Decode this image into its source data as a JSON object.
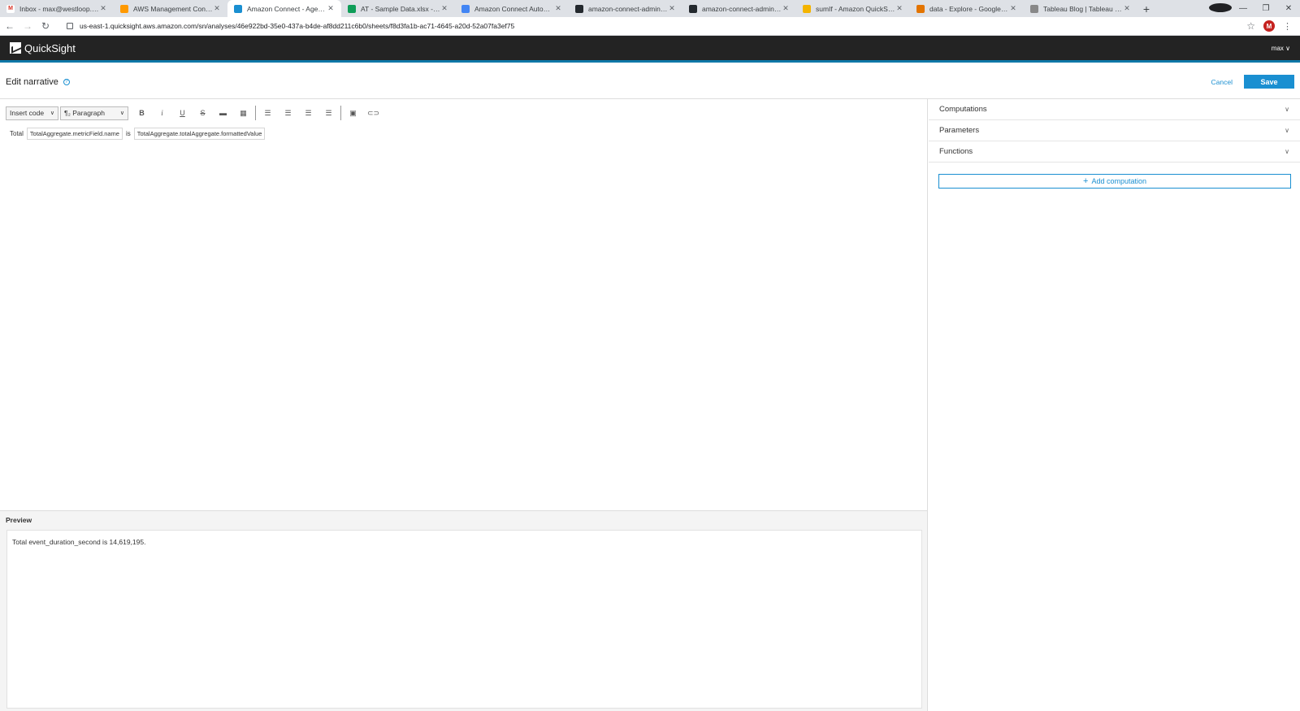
{
  "browser": {
    "tabs": [
      {
        "title": "Inbox - max@westloop.io - Wes",
        "icon_color": "#ffffff",
        "icon_glyph": "M",
        "icon_name": "gmail-icon",
        "active": false
      },
      {
        "title": "AWS Management Console",
        "icon_color": "#ff9900",
        "icon_glyph": "",
        "icon_name": "aws-icon",
        "active": false
      },
      {
        "title": "Amazon Connect - Agent Anal",
        "icon_color": "#1a8fd1",
        "icon_glyph": "",
        "icon_name": "quicksight-icon",
        "active": true
      },
      {
        "title": "AT - Sample Data.xlsx - Google",
        "icon_color": "#0f9d58",
        "icon_glyph": "",
        "icon_name": "sheets-icon",
        "active": false
      },
      {
        "title": "Amazon Connect Automated A",
        "icon_color": "#4285f4",
        "icon_glyph": "",
        "icon_name": "docs-icon",
        "active": false
      },
      {
        "title": "amazon-connect-admin-guide",
        "icon_color": "#24292e",
        "icon_glyph": "",
        "icon_name": "github-icon",
        "active": false
      },
      {
        "title": "amazon-connect-admin-guide",
        "icon_color": "#24292e",
        "icon_glyph": "",
        "icon_name": "github-icon",
        "active": false
      },
      {
        "title": "sumIf - Amazon QuickSight",
        "icon_color": "#f4b400",
        "icon_glyph": "",
        "icon_name": "quicksight-docs-icon",
        "active": false
      },
      {
        "title": "data - Explore - Google Trends",
        "icon_color": "#e37400",
        "icon_glyph": "",
        "icon_name": "trends-icon",
        "active": false
      },
      {
        "title": "Tableau Blog | Tableau Softwar",
        "icon_color": "#888888",
        "icon_glyph": "",
        "icon_name": "tableau-icon",
        "active": false
      }
    ],
    "url": "us-east-1.quicksight.aws.amazon.com/sn/analyses/46e922bd-35e0-437a-b4de-af8dd211c6b0/sheets/f8d3fa1b-ac71-4645-a20d-52a07fa3ef75",
    "profile_initial": "M"
  },
  "app": {
    "name": "QuickSight",
    "user": "max"
  },
  "editbar": {
    "title": "Edit narrative",
    "cancel_label": "Cancel",
    "save_label": "Save"
  },
  "toolbar": {
    "insert_code": "Insert code",
    "paragraph": "Paragraph",
    "paragraph_prefix": "¶₂"
  },
  "editor": {
    "word_total": "Total",
    "token_1": "TotalAggregate.metricField.name",
    "word_is": "is",
    "token_2": "TotalAggregate.totalAggregate.formattedValue"
  },
  "right_panel": {
    "sections": [
      {
        "label": "Computations"
      },
      {
        "label": "Parameters"
      },
      {
        "label": "Functions"
      }
    ],
    "add_computation": "Add computation"
  },
  "preview": {
    "title": "Preview",
    "text": "Total event_duration_second is 14,619,195."
  }
}
